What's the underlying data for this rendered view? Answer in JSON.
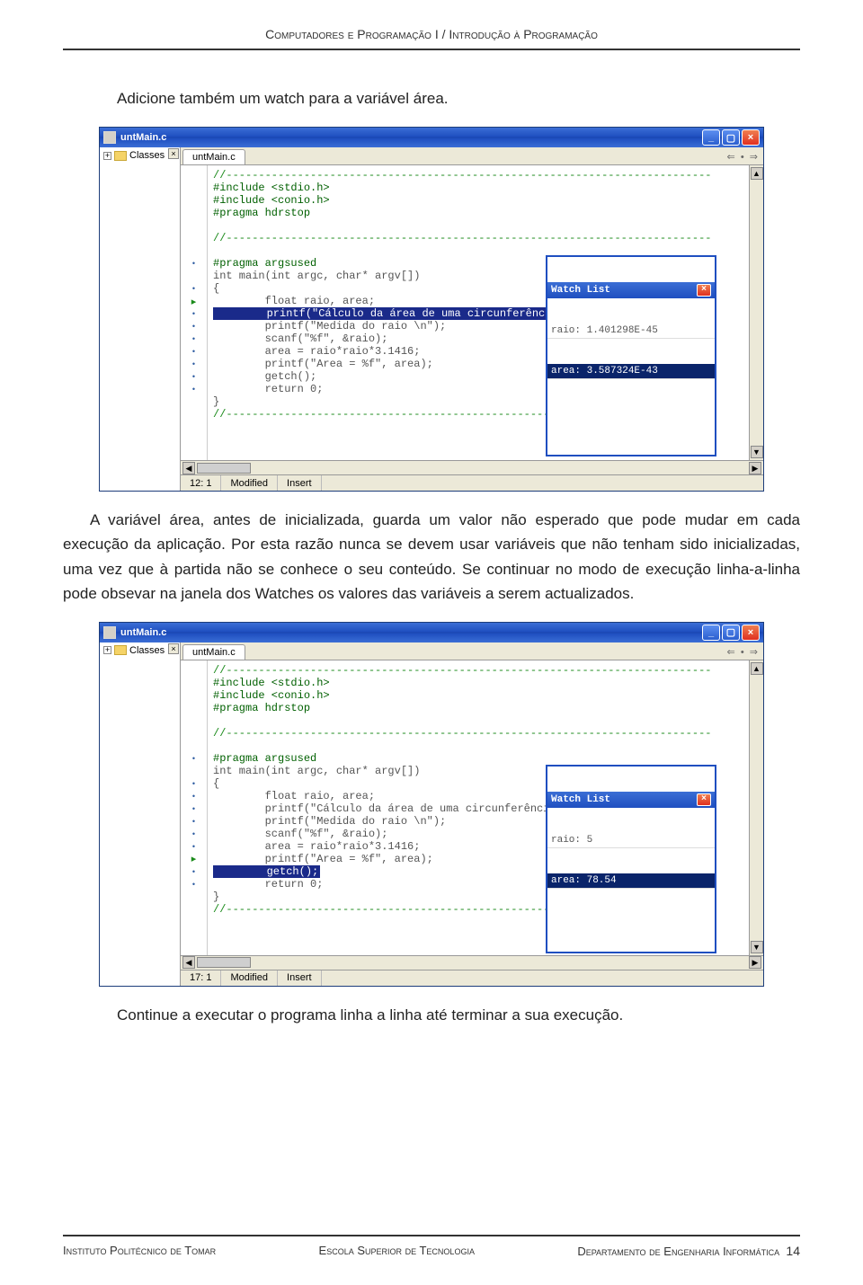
{
  "header": {
    "title": "Computadores e Programação I / Introdução à Programação"
  },
  "p1": "Adicione também um watch para a variável área.",
  "p2": "A variável área, antes de inicializada, guarda um valor não esperado que pode mudar em cada execução da aplicação. Por esta razão nunca se devem usar variáveis que não tenham sido inicializadas, uma vez que à partida não se conhece o seu conteúdo. Se continuar no modo de execução linha-a-linha pode obsevar na janela dos Watches os valores das variáveis a serem actualizados.",
  "p3": "Continue a executar o programa linha a linha até terminar a sua execução.",
  "window": {
    "title": "untMain.c",
    "sidebar_label": "Classes",
    "tab": "untMain.c"
  },
  "code_lines": {
    "l1": "//---------------------------------------------------------------------------",
    "l2": "#include <stdio.h>",
    "l3": "#include <conio.h>",
    "l4": "#pragma hdrstop",
    "l5": "//---------------------------------------------------------------------------",
    "l6": "#pragma argsused",
    "l7": "int main(int argc, char* argv[])",
    "l8": "{",
    "l9": "        float raio, area;",
    "l10": "        printf(\"Cálculo da área de uma circunferência \\n\");",
    "l11": "        printf(\"Medida do raio \\n\");",
    "l12": "        scanf(\"%f\", &raio);",
    "l13": "        area = raio*raio*3.1416;",
    "l14": "        printf(\"Area = %f\", area);",
    "l15": "        getch();",
    "l16": "        return 0;",
    "l17": "}",
    "l18": "//---------------------------------------------------------------------------"
  },
  "status1": {
    "pos": "12: 1",
    "mode": "Modified",
    "ins": "Insert"
  },
  "status2": {
    "pos": "17: 1",
    "mode": "Modified",
    "ins": "Insert"
  },
  "watch1": {
    "title": "Watch List",
    "row1": "raio: 1.401298E-45",
    "row2": "area: 3.587324E-43"
  },
  "watch2": {
    "title": "Watch List",
    "row1": "raio: 5",
    "row2": "area: 78.54"
  },
  "footer": {
    "left": "Instituto Politécnico de Tomar",
    "mid": "Escola Superior de Tecnologia",
    "right": "Departamento de Engenharia Informática",
    "page": "14"
  }
}
